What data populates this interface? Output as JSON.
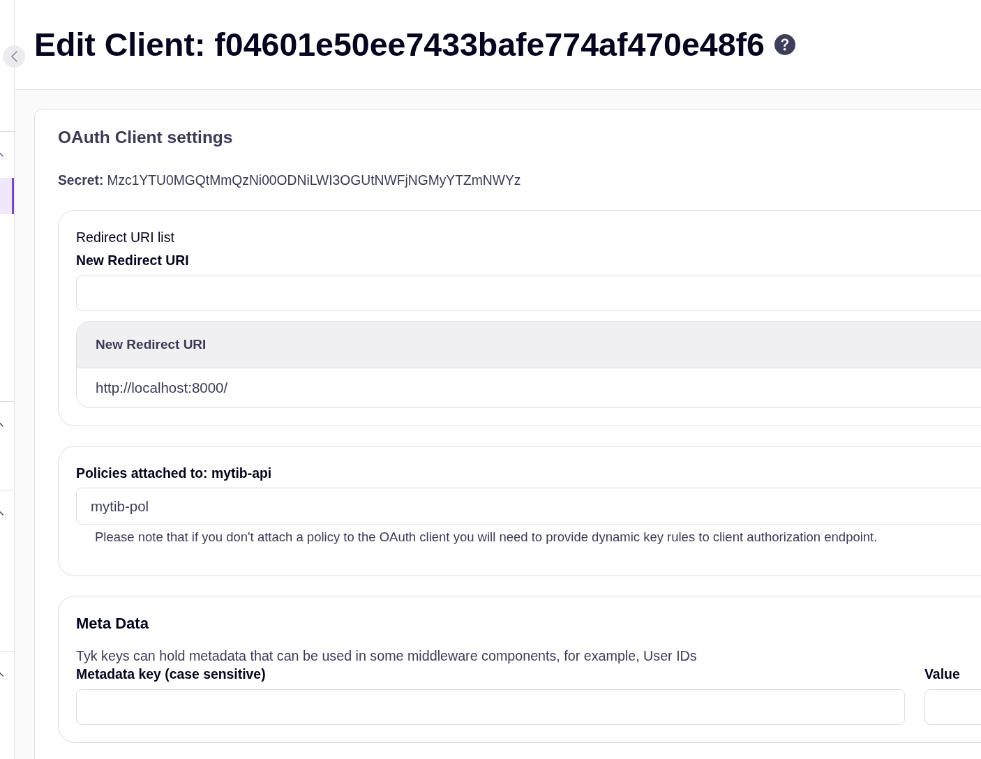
{
  "sidebar": {
    "sections": [
      {
        "expanded": true,
        "items": [
          {
            "selected": true
          },
          {
            "selected": false
          },
          {
            "selected": false
          },
          {
            "selected": false
          },
          {
            "selected": false
          },
          {
            "selected": false
          }
        ]
      },
      {
        "expanded": true,
        "items": [
          {
            "selected": false
          }
        ]
      },
      {
        "expanded": true,
        "items": [
          {
            "selected": false
          },
          {
            "selected": false
          },
          {
            "selected": false
          }
        ]
      },
      {
        "expanded": true,
        "items": [
          {
            "selected": false
          },
          {
            "selected": false
          }
        ]
      }
    ]
  },
  "header": {
    "title": "Edit Client: f04601e50ee7433bafe774af470e48f6"
  },
  "client_settings": {
    "title": "OAuth Client settings",
    "secret": {
      "label": "Secret:",
      "value": "Mzc1YTU0MGQtMmQzNi00ODNiLWI3OGUtNWFjNGMyYTZmNWYz"
    },
    "redirect_uris": {
      "title": "Redirect URI list",
      "field": {
        "label": "New Redirect URI"
      },
      "table": {
        "columns": [
          "New Redirect URI"
        ],
        "rows": [
          [
            "http://localhost:8000/"
          ]
        ]
      }
    },
    "policies": {
      "label": "Policies attached to: mytib-api",
      "field": {
        "value": "mytib-pol"
      },
      "note": "Please note that if you don't attach a policy to the OAuth client you will need to provide dynamic key rules to client authorization endpoint."
    },
    "meta_data": {
      "title": "Meta Data",
      "description": "Tyk keys can hold metadata that can be used in some middleware components, for example, User IDs",
      "fields": [
        {
          "label": "Metadata key (case sensitive)"
        },
        {
          "label": "Value"
        }
      ]
    }
  }
}
